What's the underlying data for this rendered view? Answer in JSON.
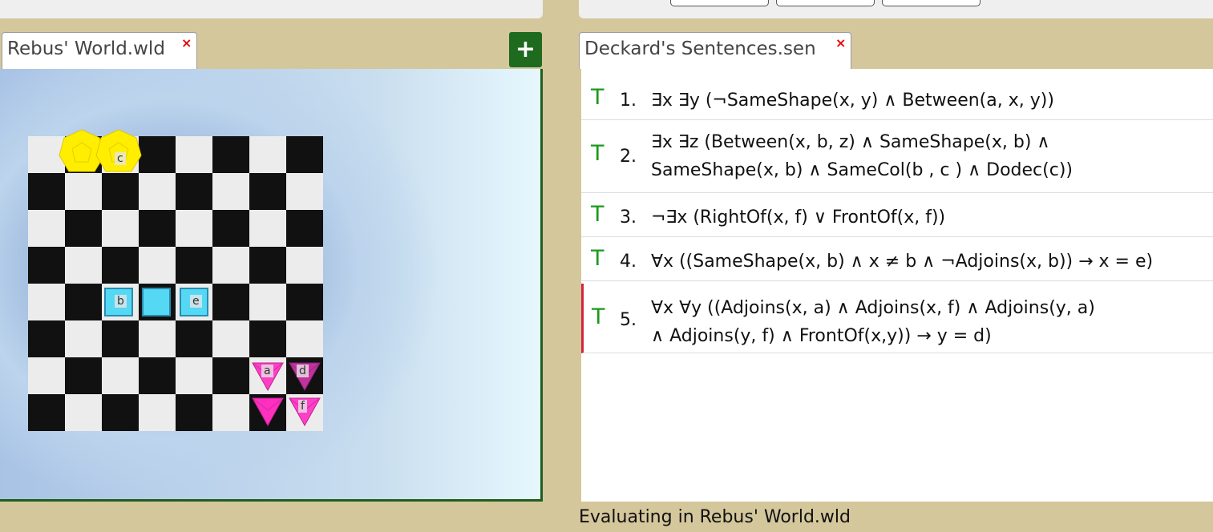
{
  "world_tab": {
    "label": "Rebus' World.wld",
    "close": "×"
  },
  "add_button": {
    "label": "+"
  },
  "sentence_tab": {
    "label": "Deckard's Sentences.sen",
    "close": "×"
  },
  "pieces": {
    "c": {
      "label": "c",
      "shape": "dodecahedron",
      "color": "#ffee00"
    },
    "b": {
      "label": "b",
      "shape": "cube",
      "color": "#55d8f4"
    },
    "e": {
      "label": "e",
      "shape": "cube",
      "color": "#55d8f4"
    },
    "a": {
      "label": "a",
      "shape": "tetrahedron",
      "color": "#ff3fc7"
    },
    "d": {
      "label": "d",
      "shape": "tetrahedron",
      "color": "#c0339c"
    },
    "f": {
      "label": "f",
      "shape": "tetrahedron",
      "color": "#ff3fc7"
    }
  },
  "sentences": [
    {
      "truth": "T",
      "number": "1.",
      "lines": [
        "∃x ∃y (¬SameShape(x, y) ∧ Between(a, x, y))"
      ]
    },
    {
      "truth": "T",
      "number": "2.",
      "lines": [
        "∃x ∃z (Between(x, b, z) ∧ SameShape(x, b) ∧",
        "SameShape(x, b) ∧ SameCol(b , c ) ∧ Dodec(c))"
      ]
    },
    {
      "truth": "T",
      "number": "3.",
      "lines": [
        " ¬∃x (RightOf(x, f) ∨ FrontOf(x, f))"
      ]
    },
    {
      "truth": "T",
      "number": "4.",
      "lines": [
        "∀x ((SameShape(x, b) ∧ x ≠ b ∧ ¬Adjoins(x, b)) → x = e)"
      ]
    },
    {
      "truth": "T",
      "number": "5.",
      "lines": [
        " ∀x ∀y ((Adjoins(x, a) ∧ Adjoins(x, f) ∧ Adjoins(y, a)",
        " ∧ Adjoins(y, f) ∧ FrontOf(x,y)) → y = d)"
      ]
    }
  ],
  "status": "Evaluating in Rebus' World.wld",
  "colors": {
    "true": "#1a9a1a",
    "selected": "#d0243c",
    "add_button": "#1e6a1e"
  }
}
